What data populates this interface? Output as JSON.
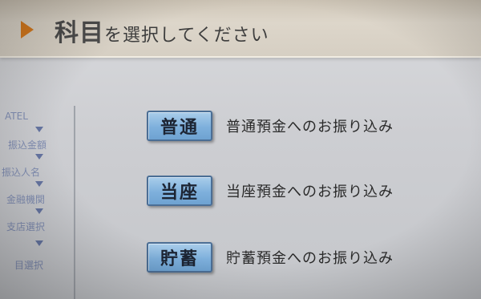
{
  "header": {
    "title_strong": "科目",
    "title_rest": "を選択してください"
  },
  "sidebar": {
    "items": [
      {
        "label": "ATEL"
      },
      {
        "label": "振込金額"
      },
      {
        "label": "振込人名"
      },
      {
        "label": "金融機関"
      },
      {
        "label": "支店選択"
      },
      {
        "label": "目選択"
      }
    ]
  },
  "options": [
    {
      "button": "普通",
      "description": "普通預金へのお振り込み"
    },
    {
      "button": "当座",
      "description": "当座預金へのお振り込み"
    },
    {
      "button": "貯蓄",
      "description": "貯蓄預金へのお振り込み"
    }
  ],
  "colors": {
    "button_fill": "#7eb0dc",
    "header_arrow": "#d67a1e",
    "screen_bg": "#cdced2"
  }
}
